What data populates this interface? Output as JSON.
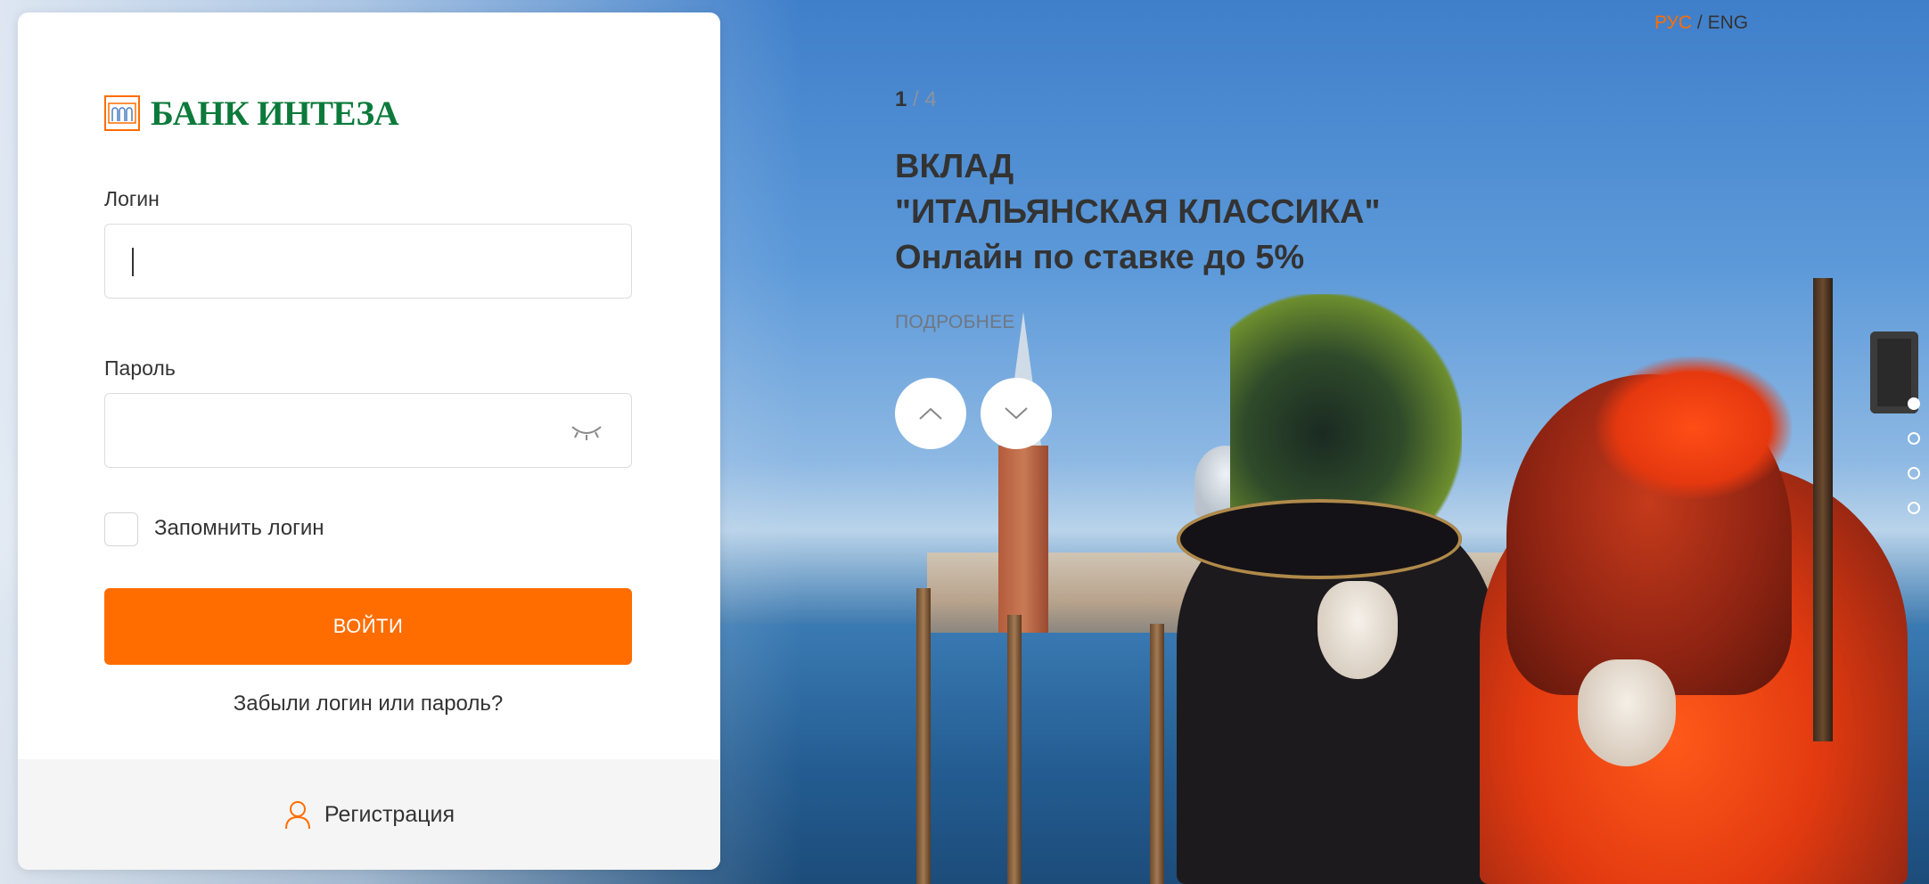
{
  "brand": {
    "name": "БАНК ИНТЕЗА",
    "accent_color": "#ff6d00",
    "logo_color": "#0b7a3b"
  },
  "login_form": {
    "login_label": "Логин",
    "login_value": "",
    "password_label": "Пароль",
    "password_value": "",
    "password_toggle_icon": "eye-closed-icon",
    "remember_label": "Запомнить логин",
    "remember_checked": false,
    "submit_label": "ВОЙТИ",
    "forgot_link": "Забыли логин или пароль?",
    "register_icon": "user-icon",
    "register_label": "Регистрация"
  },
  "language": {
    "ru": "РУС",
    "separator": "/",
    "en": "ENG",
    "active": "РУС"
  },
  "promo": {
    "current": "1",
    "total": "/ 4",
    "title_line1": "ВКЛАД",
    "title_line2": "\"ИТАЛЬЯНСКАЯ КЛАССИКА\"",
    "title_line3": "Онлайн по ставке до 5%",
    "more_link": "ПОДРОБНЕЕ",
    "prev_icon": "chevron-up-icon",
    "next_icon": "chevron-down-icon",
    "slides_count": 4,
    "active_slide": 1
  }
}
